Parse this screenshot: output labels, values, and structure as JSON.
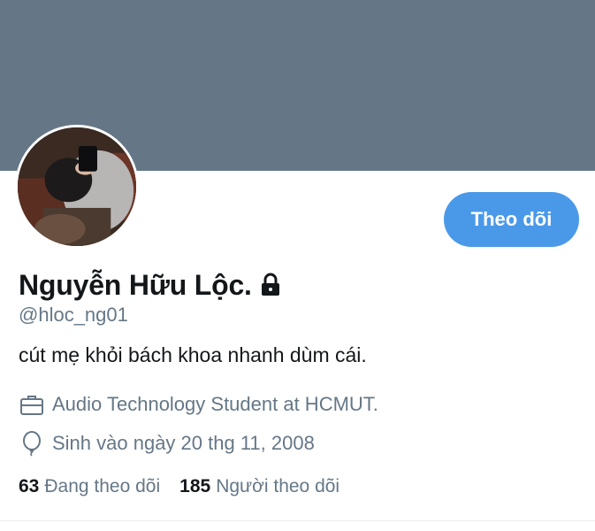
{
  "profile": {
    "display_name": "Nguyễn Hữu Lộc.",
    "handle": "@hloc_ng01",
    "bio": "cút mẹ khỏi bách khoa nhanh dùm cái.",
    "job": "Audio Technology Student at HCMUT.",
    "birthday": "Sinh vào ngày 20 thg 11, 2008",
    "protected": true
  },
  "actions": {
    "follow_label": "Theo dõi"
  },
  "stats": {
    "following_count": "63",
    "following_label": "Đang theo dõi",
    "followers_count": "185",
    "followers_label": "Người theo dõi"
  },
  "icons": {
    "lock": "lock-icon",
    "job": "briefcase-icon",
    "birthday": "balloon-icon"
  },
  "colors": {
    "banner": "#657786",
    "accent": "#4a99e9",
    "primary_text": "#14171a",
    "secondary_text": "#657786"
  }
}
